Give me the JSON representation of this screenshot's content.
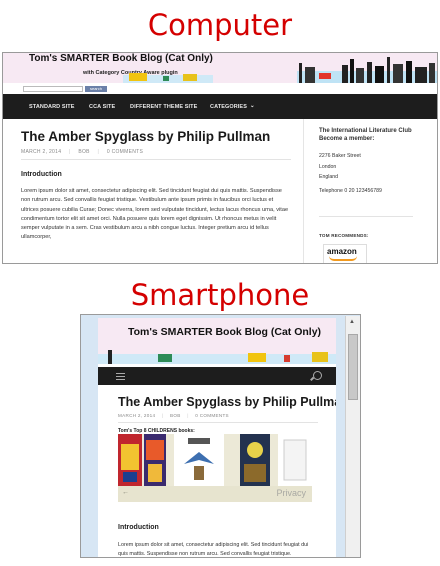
{
  "headings": {
    "computer": "Computer",
    "smartphone": "Smartphone"
  },
  "site": {
    "title_desktop": "Tom's SMARTER Book Blog (Cat Only)",
    "title_phone": "Tom's SMARTER Book Blog (Cat Only)",
    "tagline": "with Category Country Aware plugin"
  },
  "desktop": {
    "search_button": "search",
    "nav": [
      "STANDARD SITE",
      "CCA SITE",
      "DIFFERENT THEME SITE",
      "CATEGORIES"
    ],
    "article": {
      "title": "The Amber Spyglass by Philip Pullman",
      "date": "MARCH 2, 2014",
      "author": "BOB",
      "comments": "0 COMMENTS",
      "intro_heading": "Introduction",
      "body": "Lorem ipsum dolor sit amet, consectetur adipiscing elit. Sed tincidunt feugiat dui quis mattis. Suspendisse non rutrum arcu. Sed convallis feugiat tristique. Vestibulum ante ipsum primis in faucibus orci luctus et ultrices posuere cubilia Curae; Donec viverra, lorem sed vulputate tincidunt, lectus lacus rhoncus urna, vitae condimentum tortor elit sit amet orci. Nulla posuere quis lorem eget dignissim. Ut rhoncus metus in velit semper vulputate in a sem. Cras vestibulum arcu a nibh congue luctus. Integer pretium arcu id tellus ullamcorper,"
    },
    "sidebar": {
      "heading": "The International Literature Club Become a member:",
      "address": [
        "2276 Baker Street",
        "London",
        "England"
      ],
      "telephone": "Telephone 0 20 123456789",
      "recommends": "TOM RECOMMENDS:",
      "amazon": "amazon"
    }
  },
  "phone": {
    "article": {
      "title": "The Amber Spyglass by Philip Pullman",
      "date": "MARCH 2, 2014",
      "author": "BOB",
      "comments": "0 COMMENTS",
      "books_heading": "Tom's Top 8 CHILDRENS books:",
      "privacy": "Privacy",
      "intro_heading": "Introduction",
      "body": "Lorem ipsum dolor sit amet, consectetur adipiscing elit. Sed tincidunt feugiat dui quis mattis. Suspendisse non rutrum arcu. Sed convallis feugiat tristique."
    }
  }
}
